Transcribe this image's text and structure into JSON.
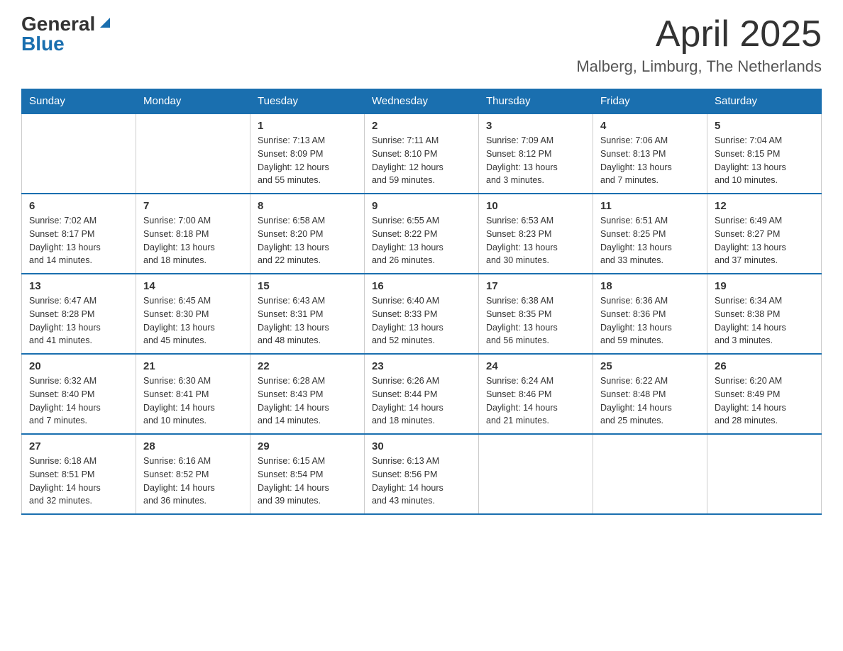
{
  "logo": {
    "general": "General",
    "blue": "Blue"
  },
  "header": {
    "month": "April 2025",
    "location": "Malberg, Limburg, The Netherlands"
  },
  "weekdays": [
    "Sunday",
    "Monday",
    "Tuesday",
    "Wednesday",
    "Thursday",
    "Friday",
    "Saturday"
  ],
  "weeks": [
    [
      {
        "day": "",
        "info": ""
      },
      {
        "day": "",
        "info": ""
      },
      {
        "day": "1",
        "info": "Sunrise: 7:13 AM\nSunset: 8:09 PM\nDaylight: 12 hours\nand 55 minutes."
      },
      {
        "day": "2",
        "info": "Sunrise: 7:11 AM\nSunset: 8:10 PM\nDaylight: 12 hours\nand 59 minutes."
      },
      {
        "day": "3",
        "info": "Sunrise: 7:09 AM\nSunset: 8:12 PM\nDaylight: 13 hours\nand 3 minutes."
      },
      {
        "day": "4",
        "info": "Sunrise: 7:06 AM\nSunset: 8:13 PM\nDaylight: 13 hours\nand 7 minutes."
      },
      {
        "day": "5",
        "info": "Sunrise: 7:04 AM\nSunset: 8:15 PM\nDaylight: 13 hours\nand 10 minutes."
      }
    ],
    [
      {
        "day": "6",
        "info": "Sunrise: 7:02 AM\nSunset: 8:17 PM\nDaylight: 13 hours\nand 14 minutes."
      },
      {
        "day": "7",
        "info": "Sunrise: 7:00 AM\nSunset: 8:18 PM\nDaylight: 13 hours\nand 18 minutes."
      },
      {
        "day": "8",
        "info": "Sunrise: 6:58 AM\nSunset: 8:20 PM\nDaylight: 13 hours\nand 22 minutes."
      },
      {
        "day": "9",
        "info": "Sunrise: 6:55 AM\nSunset: 8:22 PM\nDaylight: 13 hours\nand 26 minutes."
      },
      {
        "day": "10",
        "info": "Sunrise: 6:53 AM\nSunset: 8:23 PM\nDaylight: 13 hours\nand 30 minutes."
      },
      {
        "day": "11",
        "info": "Sunrise: 6:51 AM\nSunset: 8:25 PM\nDaylight: 13 hours\nand 33 minutes."
      },
      {
        "day": "12",
        "info": "Sunrise: 6:49 AM\nSunset: 8:27 PM\nDaylight: 13 hours\nand 37 minutes."
      }
    ],
    [
      {
        "day": "13",
        "info": "Sunrise: 6:47 AM\nSunset: 8:28 PM\nDaylight: 13 hours\nand 41 minutes."
      },
      {
        "day": "14",
        "info": "Sunrise: 6:45 AM\nSunset: 8:30 PM\nDaylight: 13 hours\nand 45 minutes."
      },
      {
        "day": "15",
        "info": "Sunrise: 6:43 AM\nSunset: 8:31 PM\nDaylight: 13 hours\nand 48 minutes."
      },
      {
        "day": "16",
        "info": "Sunrise: 6:40 AM\nSunset: 8:33 PM\nDaylight: 13 hours\nand 52 minutes."
      },
      {
        "day": "17",
        "info": "Sunrise: 6:38 AM\nSunset: 8:35 PM\nDaylight: 13 hours\nand 56 minutes."
      },
      {
        "day": "18",
        "info": "Sunrise: 6:36 AM\nSunset: 8:36 PM\nDaylight: 13 hours\nand 59 minutes."
      },
      {
        "day": "19",
        "info": "Sunrise: 6:34 AM\nSunset: 8:38 PM\nDaylight: 14 hours\nand 3 minutes."
      }
    ],
    [
      {
        "day": "20",
        "info": "Sunrise: 6:32 AM\nSunset: 8:40 PM\nDaylight: 14 hours\nand 7 minutes."
      },
      {
        "day": "21",
        "info": "Sunrise: 6:30 AM\nSunset: 8:41 PM\nDaylight: 14 hours\nand 10 minutes."
      },
      {
        "day": "22",
        "info": "Sunrise: 6:28 AM\nSunset: 8:43 PM\nDaylight: 14 hours\nand 14 minutes."
      },
      {
        "day": "23",
        "info": "Sunrise: 6:26 AM\nSunset: 8:44 PM\nDaylight: 14 hours\nand 18 minutes."
      },
      {
        "day": "24",
        "info": "Sunrise: 6:24 AM\nSunset: 8:46 PM\nDaylight: 14 hours\nand 21 minutes."
      },
      {
        "day": "25",
        "info": "Sunrise: 6:22 AM\nSunset: 8:48 PM\nDaylight: 14 hours\nand 25 minutes."
      },
      {
        "day": "26",
        "info": "Sunrise: 6:20 AM\nSunset: 8:49 PM\nDaylight: 14 hours\nand 28 minutes."
      }
    ],
    [
      {
        "day": "27",
        "info": "Sunrise: 6:18 AM\nSunset: 8:51 PM\nDaylight: 14 hours\nand 32 minutes."
      },
      {
        "day": "28",
        "info": "Sunrise: 6:16 AM\nSunset: 8:52 PM\nDaylight: 14 hours\nand 36 minutes."
      },
      {
        "day": "29",
        "info": "Sunrise: 6:15 AM\nSunset: 8:54 PM\nDaylight: 14 hours\nand 39 minutes."
      },
      {
        "day": "30",
        "info": "Sunrise: 6:13 AM\nSunset: 8:56 PM\nDaylight: 14 hours\nand 43 minutes."
      },
      {
        "day": "",
        "info": ""
      },
      {
        "day": "",
        "info": ""
      },
      {
        "day": "",
        "info": ""
      }
    ]
  ]
}
